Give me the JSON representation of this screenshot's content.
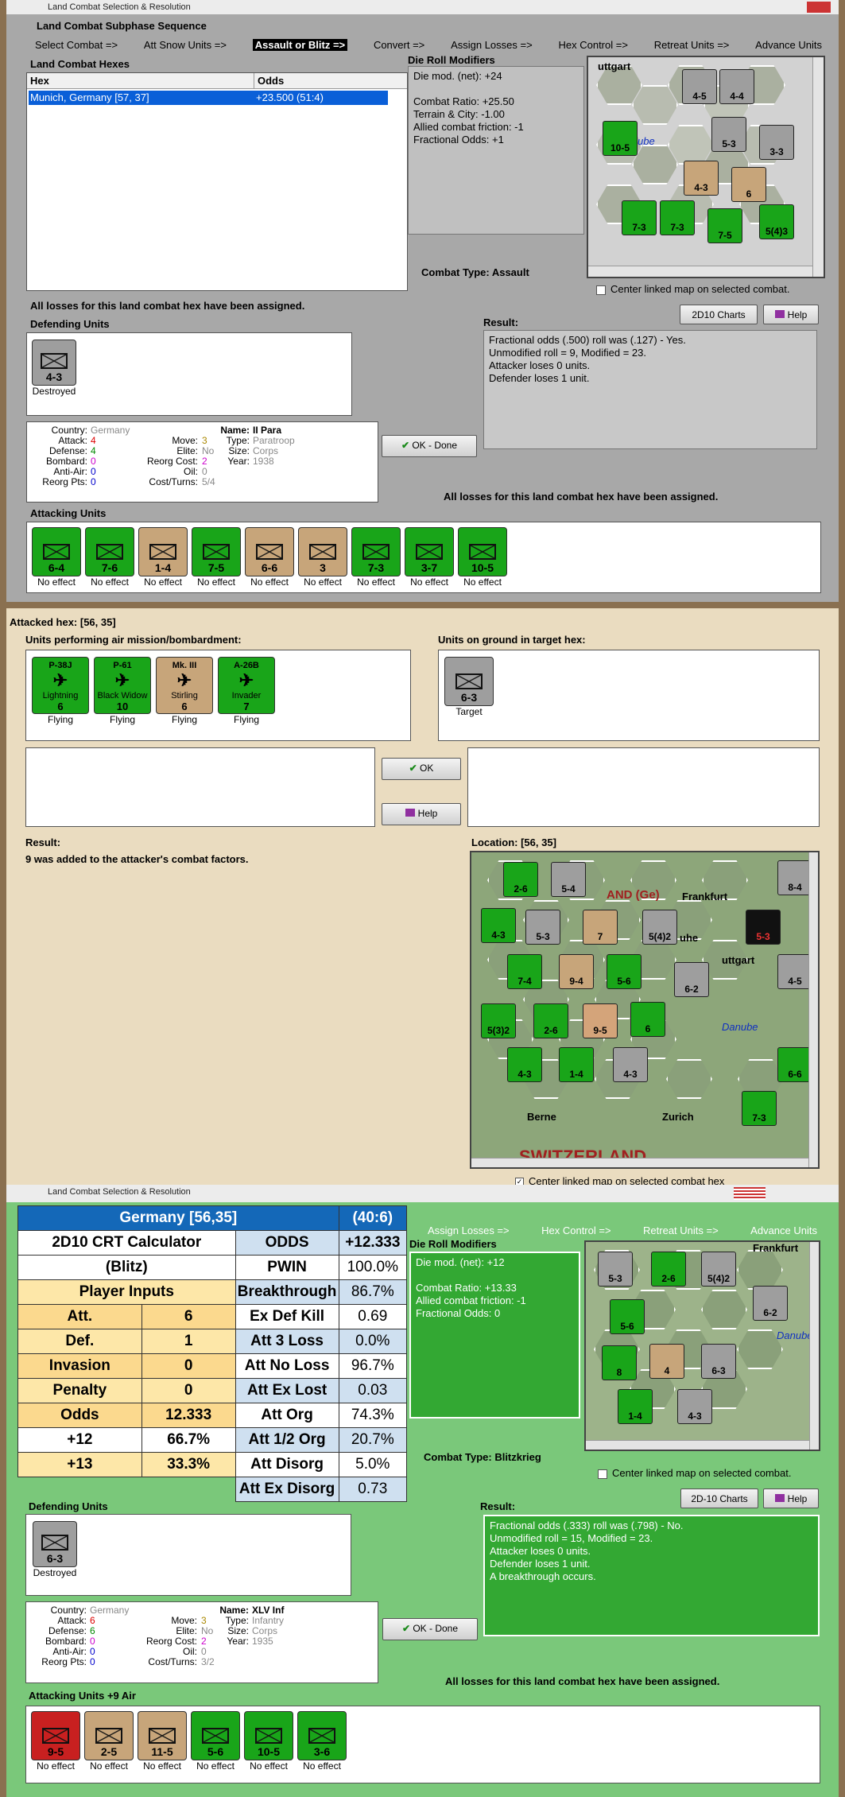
{
  "top": {
    "window_title": "Land Combat Selection & Resolution",
    "sequence_title": "Land Combat Subphase Sequence",
    "sequence": [
      "Select Combat =>",
      "Att Snow Units =>",
      "Assault or Blitz =>",
      "Convert =>",
      "Assign Losses =>",
      "Hex Control =>",
      "Retreat Units =>",
      "Advance Units"
    ],
    "hexes_label": "Land Combat Hexes",
    "hexes_columns": [
      "Hex",
      "Odds"
    ],
    "hexes_rows": [
      {
        "hex": "Munich, Germany [57, 37]",
        "odds": "+23.500 (51:4)"
      }
    ],
    "drm_label": "Die Roll Modifiers",
    "drm_lines": [
      "Die mod. (net): +24",
      "",
      "Combat Ratio: +25.50",
      "Terrain & City: -1.00",
      "Allied combat friction: -1",
      "Fractional Odds: +1"
    ],
    "combat_type": "Combat Type:  Assault",
    "center_map": "Center linked map on selected combat.",
    "losses_msg": "All losses for this land combat hex have been assigned.",
    "defending_label": "Defending Units",
    "defender": {
      "name": "II Para",
      "value": "4-3",
      "status": "Destroyed"
    },
    "charts_btn": "2D10 Charts",
    "help_btn": "Help",
    "result_label": "Result:",
    "result_lines": [
      "Fractional odds (.500) roll was (.127)  - Yes.",
      "Unmodified roll = 9, Modified = 23.",
      "Attacker loses 0 units.",
      "Defender loses 1 unit."
    ],
    "unit_info": {
      "country_k": "Country:",
      "country_v": "Germany",
      "attack_k": "Attack:",
      "attack_v": "4",
      "defense_k": "Defense:",
      "defense_v": "4",
      "bombard_k": "Bombard:",
      "bombard_v": "0",
      "antiair_k": "Anti-Air:",
      "antiair_v": "0",
      "reorg_k": "Reorg Pts:",
      "reorg_v": "0",
      "move_k": "Move:",
      "move_v": "3",
      "elite_k": "Elite:",
      "elite_v": "No",
      "reorgcost_k": "Reorg Cost:",
      "reorgcost_v": "2",
      "oil_k": "Oil:",
      "oil_v": "0",
      "cost_k": "Cost/Turns:",
      "cost_v": "5/4",
      "name_k": "Name:",
      "name_v": "II Para",
      "type_k": "Type:",
      "type_v": "Paratroop",
      "size_k": "Size:",
      "size_v": "Corps",
      "year_k": "Year:",
      "year_v": "1938"
    },
    "ok_btn": "OK - Done",
    "losses_msg2": "All losses for this land combat hex have been assigned.",
    "attacking_label": "Attacking Units",
    "attackers": [
      {
        "value": "6-4",
        "status": "No effect",
        "color": "#19a519"
      },
      {
        "value": "7-6",
        "status": "No effect",
        "color": "#19a519"
      },
      {
        "value": "1-4",
        "status": "No effect",
        "color": "#c7a57a"
      },
      {
        "value": "7-5",
        "status": "No effect",
        "color": "#19a519"
      },
      {
        "value": "6-6",
        "status": "No effect",
        "color": "#c7a57a"
      },
      {
        "value": "3",
        "status": "No effect",
        "color": "#c7a57a"
      },
      {
        "value": "7-3",
        "status": "No effect",
        "color": "#19a519"
      },
      {
        "value": "3-7",
        "status": "No effect",
        "color": "#19a519"
      },
      {
        "value": "10-5",
        "status": "No effect",
        "color": "#19a519"
      }
    ],
    "map_labels": [
      "uttgart",
      "ube"
    ]
  },
  "middle": {
    "attacked_hex": "Attacked hex:  [56, 35]",
    "air_label": "Units performing air mission/bombardment:",
    "air_units": [
      {
        "name": "P-38J",
        "sub": "Lightning",
        "value": "6",
        "status": "Flying"
      },
      {
        "name": "P-61",
        "sub": "Black Widow",
        "value": "10",
        "status": "Flying"
      },
      {
        "name": "Mk. III",
        "sub": "Stirling",
        "value": "6",
        "status": "Flying"
      },
      {
        "name": "A-26B",
        "sub": "Invader",
        "value": "7",
        "status": "Flying"
      }
    ],
    "ground_label": "Units on ground in target hex:",
    "ground_unit": {
      "name": "XLV Inf",
      "value": "6-3",
      "status": "Target"
    },
    "ok_btn": "OK",
    "help_btn": "Help",
    "result_label": "Result:",
    "result_text": "9 was added to the attacker's combat factors.",
    "location": "Location:  [56, 35]",
    "center_map": "Center linked map on selected combat hex",
    "map_labels": [
      "Frankfurt",
      "uhe",
      "uttgart",
      "Danube",
      "Berne",
      "Zurich",
      "SWITZERLAND",
      "AND (Ge)"
    ]
  },
  "bottom": {
    "window_title": "Land Combat Selection & Resolution",
    "sequence": [
      "Assign Losses =>",
      "Hex Control =>",
      "Retreat Units =>",
      "Advance Units"
    ],
    "crt": {
      "header_left": "Germany [56,35]",
      "header_right": "(40:6)",
      "calc_title": "2D10 CRT Calculator",
      "calc_sub": "(Blitz)",
      "inputs_title": "Player Inputs",
      "inputs": [
        {
          "k": "Att.",
          "v": "6"
        },
        {
          "k": "Def.",
          "v": "1"
        },
        {
          "k": "Invasion",
          "v": "0"
        },
        {
          "k": "Penalty",
          "v": "0"
        },
        {
          "k": "Odds",
          "v": "12.333"
        },
        {
          "k": "+12",
          "v": "66.7%"
        },
        {
          "k": "+13",
          "v": "33.3%"
        }
      ],
      "results": [
        {
          "k": "ODDS",
          "v": "+12.333"
        },
        {
          "k": "PWIN",
          "v": "100.0%"
        },
        {
          "k": "Breakthrough",
          "v": "86.7%"
        },
        {
          "k": "Ex Def Kill",
          "v": "0.69"
        },
        {
          "k": "Att 3 Loss",
          "v": "0.0%"
        },
        {
          "k": "Att No Loss",
          "v": "96.7%"
        },
        {
          "k": "Att Ex Lost",
          "v": "0.03"
        },
        {
          "k": "Att Org",
          "v": "74.3%"
        },
        {
          "k": "Att 1/2 Org",
          "v": "20.7%"
        },
        {
          "k": "Att Disorg",
          "v": "5.0%"
        },
        {
          "k": "Att Ex Disorg",
          "v": "0.73"
        }
      ]
    },
    "drm_label": "Die Roll Modifiers",
    "drm_lines": [
      "Die mod. (net): +12",
      "",
      "Combat Ratio: +13.33",
      "Allied combat friction: -1",
      "Fractional Odds:  0"
    ],
    "combat_type": "Combat Type:  Blitzkrieg",
    "center_map": "Center linked map on selected combat.",
    "charts_btn": "2D-10 Charts",
    "help_btn": "Help",
    "defending_label": "Defending Units",
    "defender": {
      "name": "XLV Inf",
      "value": "6-3",
      "status": "Destroyed"
    },
    "result_label": "Result:",
    "result_lines": [
      "Fractional odds (.333) roll was (.798)  - No.",
      "Unmodified roll = 15, Modified = 23.",
      "Attacker loses 0 units.",
      "Defender loses 1 unit.",
      "A breakthrough occurs."
    ],
    "unit_info": {
      "country_k": "Country:",
      "country_v": "Germany",
      "attack_k": "Attack:",
      "attack_v": "6",
      "defense_k": "Defense:",
      "defense_v": "6",
      "bombard_k": "Bombard:",
      "bombard_v": "0",
      "antiair_k": "Anti-Air:",
      "antiair_v": "0",
      "reorg_k": "Reorg Pts:",
      "reorg_v": "0",
      "move_k": "Move:",
      "move_v": "3",
      "elite_k": "Elite:",
      "elite_v": "No",
      "reorgcost_k": "Reorg Cost:",
      "reorgcost_v": "2",
      "oil_k": "Oil:",
      "oil_v": "0",
      "cost_k": "Cost/Turns:",
      "cost_v": "3/2",
      "name_k": "Name:",
      "name_v": "XLV Inf",
      "type_k": "Type:",
      "type_v": "Infantry",
      "size_k": "Size:",
      "size_v": "Corps",
      "year_k": "Year:",
      "year_v": "1935"
    },
    "ok_btn": "OK - Done",
    "losses_msg": "All losses for this land combat hex have been assigned.",
    "attacking_label": "Attacking Units +9 Air",
    "attackers": [
      {
        "value": "9-5",
        "status": "No effect",
        "color": "#c82020"
      },
      {
        "value": "2-5",
        "status": "No effect",
        "color": "#c7a57a"
      },
      {
        "value": "11-5",
        "status": "No effect",
        "color": "#c7a57a"
      },
      {
        "value": "5-6",
        "status": "No effect",
        "color": "#19a519"
      },
      {
        "value": "10-5",
        "status": "No effect",
        "color": "#19a519"
      },
      {
        "value": "3-6",
        "status": "No effect",
        "color": "#19a519"
      }
    ],
    "map_labels": [
      "Frankfurt",
      "Danube"
    ]
  }
}
